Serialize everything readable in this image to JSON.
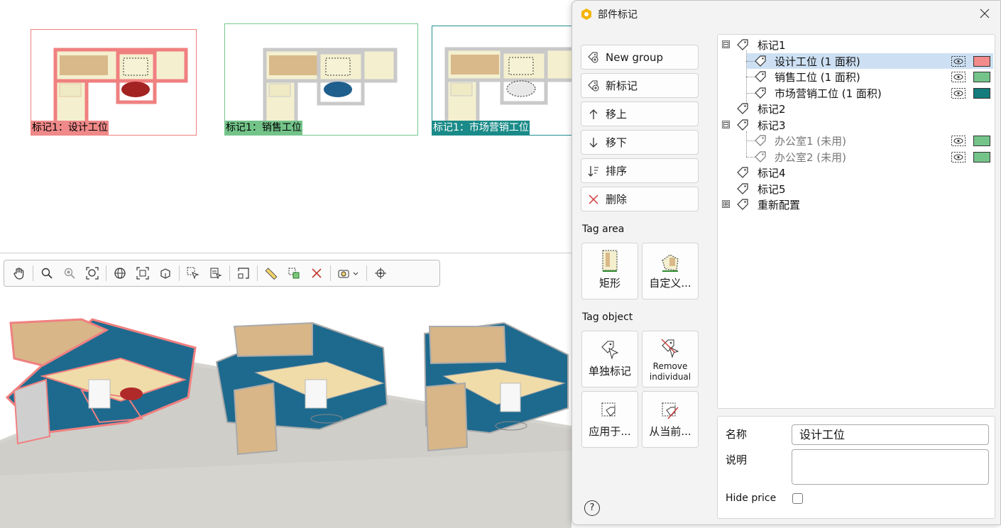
{
  "plan": {
    "cards": [
      {
        "label": "标记1：设计工位",
        "color": "#f08a8a"
      },
      {
        "label": "标记1：销售工位",
        "color": "#74c48a"
      },
      {
        "label": "标记1：市场营销工位",
        "color": "#1a8b88"
      }
    ]
  },
  "toolbar": {
    "tools": [
      "pan-hand-icon",
      "zoom-in-icon",
      "zoom-out-icon",
      "zoom-fit-icon",
      "orbit-icon",
      "frame-selection-icon",
      "frame-all-icon",
      "select-icon",
      "select-properties-icon",
      "dimension-icon",
      "measure-icon",
      "tag-add-icon",
      "clear-icon",
      "camera-icon",
      "target-icon"
    ]
  },
  "dialog": {
    "title": "部件标记",
    "buttons": {
      "new_group": "New group",
      "new_tag": "新标记",
      "move_up": "移上",
      "move_down": "移下",
      "sort": "排序",
      "delete": "删除"
    },
    "tag_area": {
      "heading": "Tag area",
      "rect": "矩形",
      "custom": "自定义..."
    },
    "tag_object": {
      "heading": "Tag object",
      "single": "单独标记",
      "remove_line1": "Remove",
      "remove_line2": "individual",
      "apply_to": "应用于...",
      "from_current": "从当前..."
    },
    "help": "?",
    "tree": [
      {
        "label": "标记1",
        "level": 0,
        "expander": "⊟"
      },
      {
        "label": "设计工位 (1 面积)",
        "level": 1,
        "selected": true,
        "swatch": "#f28b8b"
      },
      {
        "label": "销售工位 (1 面积)",
        "level": 1,
        "swatch": "#74c48a"
      },
      {
        "label": "市场营销工位 (1 面积)",
        "level": 1,
        "swatch": "#137c7c"
      },
      {
        "label": "标记2",
        "level": 0
      },
      {
        "label": "标记3",
        "level": 0,
        "expander": "⊟"
      },
      {
        "label": "办公室1 (未用)",
        "level": 1,
        "dim": true,
        "swatch": "#74c48a"
      },
      {
        "label": "办公室2 (未用)",
        "level": 1,
        "dim": true,
        "swatch": "#74c48a"
      },
      {
        "label": "标记4",
        "level": 0
      },
      {
        "label": "标记5",
        "level": 0
      },
      {
        "label": "重新配置",
        "level": 0,
        "expander": "⊞"
      }
    ],
    "props": {
      "name_label": "名称",
      "name_value": "设计工位",
      "desc_label": "说明",
      "desc_value": "",
      "hide_price_label": "Hide price",
      "hide_price_checked": false
    }
  }
}
